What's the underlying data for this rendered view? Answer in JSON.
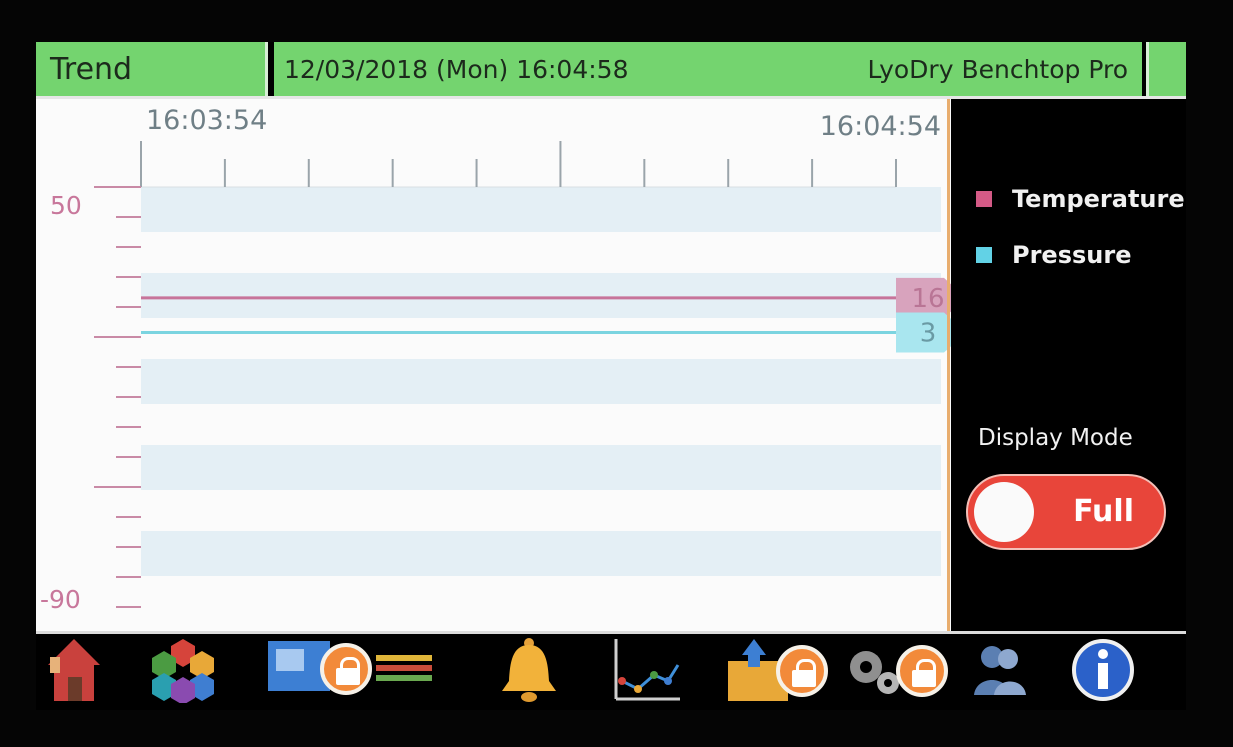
{
  "header": {
    "title": "Trend",
    "datetime": "12/03/2018 (Mon) 16:04:58",
    "device": "LyoDry Benchtop Pro"
  },
  "chart": {
    "time_start": "16:03:54",
    "time_end": "16:04:54",
    "y_max_label": "50",
    "y_min_label": "-90",
    "pressure_marker": "3",
    "temperature_marker": "16"
  },
  "chart_data": {
    "type": "line",
    "x": [
      "16:03:54",
      "16:04:54"
    ],
    "ylim": [
      -90,
      50
    ],
    "series": [
      {
        "name": "Temperature",
        "values": [
          16,
          16
        ],
        "color": "#c7749a"
      },
      {
        "name": "Pressure",
        "values": [
          3,
          3
        ],
        "color": "#7bd4e0"
      }
    ]
  },
  "legend": {
    "temperature": "Temperature",
    "pressure": "Pressure",
    "temperature_color": "#d45a86",
    "pressure_color": "#62d2e6"
  },
  "display_mode": {
    "label": "Display Mode",
    "value": "Full"
  },
  "toolbar": {
    "icons": [
      "home-icon",
      "hexagon-cluster-icon",
      "process-icon",
      "alarm-bell-icon",
      "trend-chart-icon",
      "upload-box-icon",
      "settings-gears-icon",
      "users-icon",
      "info-icon"
    ]
  }
}
